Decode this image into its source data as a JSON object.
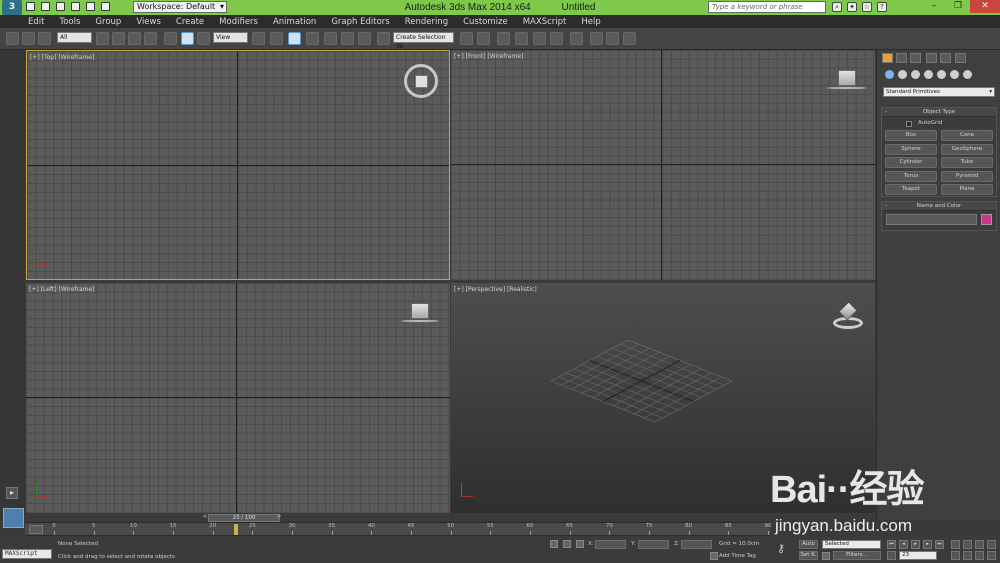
{
  "titlebar": {
    "workspace": "Workspace: Default",
    "app_name": "Autodesk 3ds Max  2014 x64",
    "doc_name": "Untitled",
    "search_placeholder": "Type a keyword or phrase"
  },
  "menu": [
    "Edit",
    "Tools",
    "Group",
    "Views",
    "Create",
    "Modifiers",
    "Animation",
    "Graph Editors",
    "Rendering",
    "Customize",
    "MAXScript",
    "Help"
  ],
  "toolbar": {
    "filter_value": "All",
    "refcoord_value": "View",
    "selection_set_value": "Create Selection Se"
  },
  "viewports": {
    "top": "[+] [Top] [Wireframe]",
    "front": "[+] [Front] [Wireframe]",
    "left": "[+] [Left] [Wireframe]",
    "perspective": "[+] [Perspective] [Realistic]"
  },
  "command_panel": {
    "category": "Standard Primitives",
    "object_type_title": "Object Type",
    "autogrid_label": "AutoGrid",
    "buttons": [
      "Box",
      "Cone",
      "Sphere",
      "GeoSphere",
      "Cylinder",
      "Tube",
      "Torus",
      "Pyramid",
      "Teapot",
      "Plane"
    ],
    "name_color_title": "Name and Color",
    "color": "#d0358a"
  },
  "timeline": {
    "frame_display": "23 / 100",
    "ticks": [
      "0",
      "5",
      "10",
      "15",
      "20",
      "25",
      "30",
      "35",
      "40",
      "45",
      "50",
      "55",
      "60",
      "65",
      "70",
      "75",
      "80",
      "85",
      "90"
    ],
    "current_frame": 23
  },
  "status": {
    "maxscript": "MAXScript",
    "selection": "None Selected",
    "prompt": "Click and drag to select and rotate objects",
    "x_label": "X:",
    "y_label": "Y:",
    "z_label": "Z:",
    "grid": "Grid = 10.0cm",
    "add_time_tag": "Add Time Tag",
    "auto_key": "Auto",
    "set_key": "Set K.",
    "key_filter": "Selected",
    "filters": "Filters...",
    "frame_field": "23"
  },
  "watermark": {
    "logo": "Bai··经验",
    "url": "jingyan.baidu.com"
  }
}
